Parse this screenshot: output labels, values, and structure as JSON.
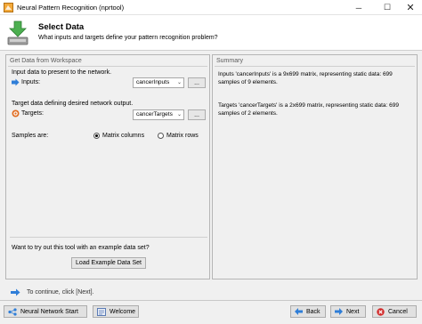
{
  "window": {
    "title": "Neural Pattern Recognition (nprtool)"
  },
  "header": {
    "title": "Select Data",
    "subtitle": "What inputs and targets define your pattern recognition problem?"
  },
  "left_panel": {
    "title": "Get Data from Workspace",
    "inputs_desc": "Input data to present to the network.",
    "inputs_label": "Inputs:",
    "inputs_value": "cancerInputs",
    "targets_desc": "Target data defining desired network output.",
    "targets_label": "Targets:",
    "targets_value": "cancerTargets",
    "browse_label": "...",
    "samples_label": "Samples are:",
    "radio_columns": "Matrix columns",
    "radio_rows": "Matrix rows",
    "example_prompt": "Want to try out this tool with an example data set?",
    "load_example": "Load Example Data Set"
  },
  "right_panel": {
    "title": "Summary",
    "inputs_summary": "Inputs 'cancerInputs' is a 9x699 matrix, representing static data: 699 samples of 9 elements.",
    "targets_summary": "Targets 'cancerTargets' is a 2x699 matrix, representing static data: 699 samples of 2 elements."
  },
  "footer": {
    "continue_hint": "To continue, click [Next].",
    "nn_start": "Neural Network Start",
    "welcome": "Welcome",
    "back": "Back",
    "next": "Next",
    "cancel": "Cancel"
  },
  "colors": {
    "accent_green": "#3a9a3a",
    "arrow_blue": "#2f7ed8",
    "cancel_red": "#d22b2b",
    "target_orange": "#e06b1f"
  },
  "icons": [
    "app-icon",
    "download-data-icon",
    "input-icon",
    "target-icon",
    "continue-arrow-icon"
  ]
}
